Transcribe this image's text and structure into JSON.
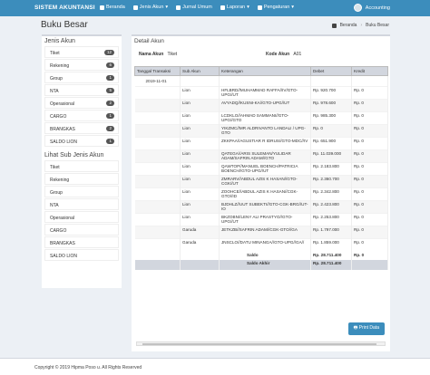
{
  "topbar": {
    "brand": "SISTEM AKUNTANSI",
    "nav": [
      "Beranda",
      "Jenis Akun",
      "Jurnal Umum",
      "Laporan",
      "Pengaturan"
    ],
    "user": "Accounting"
  },
  "page": {
    "title": "Buku Besar",
    "crumb_home": "Beranda",
    "crumb_current": "Buku Besar"
  },
  "sidebar": {
    "title": "Jenis Akun",
    "items": [
      {
        "label": "Tiket",
        "count": "12"
      },
      {
        "label": "Rekening",
        "count": "6"
      },
      {
        "label": "Group",
        "count": "1"
      },
      {
        "label": "NTA",
        "count": "5"
      },
      {
        "label": "Operasional",
        "count": "2"
      },
      {
        "label": "CARGO",
        "count": "1"
      },
      {
        "label": "BRANGKAS",
        "count": "2"
      },
      {
        "label": "SALDO LION",
        "count": "1"
      }
    ],
    "sub_title": "Lihat Sub Jenis Akun",
    "sub_items": [
      "Tiket",
      "Rekening",
      "Group",
      "NTA",
      "Operasional",
      "CARGO",
      "BRANGKAS",
      "SALDO LION"
    ]
  },
  "detail": {
    "title": "Detail Akun",
    "nama_label": "Nama Akun",
    "nama_value": "Tiket",
    "kode_label": "Kode Akun",
    "kode_value": "A01",
    "headers": [
      "Tanggal Transaksi",
      "Sub Akun",
      "Keterangan",
      "Debet",
      "Kredit"
    ],
    "date": "2019-11-01",
    "rows": [
      {
        "sub": "Lion",
        "ket": "HFLBRD//MUHAMMAD RAFFA//IV/GTO-UPG//UT",
        "debet": "Rp. 920.700",
        "kredit": "Rp. 0"
      },
      {
        "sub": "Lion",
        "ket": "AVYADQ//KUSNI-KA//GTO-UPG//UT",
        "debet": "Rp. 978.600",
        "kredit": "Rp. 0"
      },
      {
        "sub": "Lion",
        "ket": "LCDKLO//AHMAD SAMMANI//GTO-UPG//GTO",
        "debet": "Rp. 985.300",
        "kredit": "Rp. 0"
      },
      {
        "sub": "Lion",
        "ket": "YIKZMC//MR ALDRIVANTO LANDALI / UPG-GTO",
        "debet": "Rp. 0",
        "kredit": "Rp. 0"
      },
      {
        "sub": "Lion",
        "ket": "ZKKPAA//AGUSTIAR R IDRUS//GTO-MDC//IV",
        "debet": "Rp. 651.900",
        "kredit": "Rp. 0"
      },
      {
        "sub": "Lion",
        "ket": "QATEGA//ARIS SULEMAN/YULIDAR ADAM/SAFRIN ADAM//GTO",
        "debet": "Rp. 11.039.000",
        "kredit": "Rp. 0"
      },
      {
        "sub": "Lion",
        "ket": "QAWTOP//MANUEL BOENCH/PATRICIA BOENCH//GTO-UPG//UT",
        "debet": "Rp. 2.183.800",
        "kredit": "Rp. 0"
      },
      {
        "sub": "Lion",
        "ket": "ZMRARV//ABDUL AZIS K HASAN//GTO-CGK//UT",
        "debet": "Rp. 2.360.700",
        "kredit": "Rp. 0"
      },
      {
        "sub": "Lion",
        "ket": "ZOOHCE//ABDUL AZIS K HASAN//CGK-GTO//ID",
        "debet": "Rp. 2.342.800",
        "kredit": "Rp. 0"
      },
      {
        "sub": "Lion",
        "ket": "BJDHLZ//UUT SUBEKTI//GTO-CGK-BRG//UT-IO",
        "debet": "Rp. 2.423.800",
        "kredit": "Rp. 0"
      },
      {
        "sub": "Lion",
        "ket": "BKZOBN//LENY ALI PRASTYO//GTO-UPG//UT",
        "debet": "Rp. 2.253.800",
        "kredit": "Rp. 0"
      },
      {
        "sub": "Garuda",
        "ket": "JETKZB//SAFRIN ADAM//CGK-GTO//GA",
        "debet": "Rp. 1.797.000",
        "kredit": "Rp. 0"
      },
      {
        "sub": "Garuda",
        "ket": "JNSCLO//DATU MINANGA//GTO-UPG//GA//",
        "debet": "Rp. 1.859.000",
        "kredit": "Rp. 0"
      }
    ],
    "saldo_label": "Saldo",
    "saldo_debet": "Rp. 28.711.400",
    "saldo_kredit": "Rp. 0",
    "akhir_label": "Saldo Akhir",
    "akhir_value": "Rp. 28.711.400",
    "print_label": "Print Data"
  },
  "footer": "Copyright © 2019 Hipma Poso u. All Rights Reserved"
}
